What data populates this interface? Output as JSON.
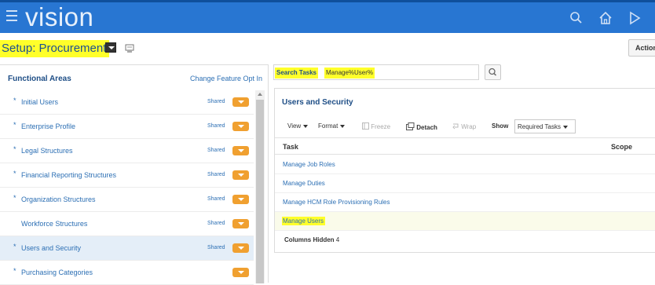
{
  "app": {
    "brand": "vision"
  },
  "topbar_icons": [
    "search-icon",
    "home-icon",
    "navigator-icon"
  ],
  "setup": {
    "title": "Setup: Procurement"
  },
  "action_button": "Action",
  "functional_areas": {
    "header": "Functional Areas",
    "change_link": "Change Feature Opt In",
    "items": [
      {
        "label": "Initial Users",
        "required": true,
        "status": "Shared"
      },
      {
        "label": "Enterprise Profile",
        "required": true,
        "status": "Shared"
      },
      {
        "label": "Legal Structures",
        "required": true,
        "status": "Shared"
      },
      {
        "label": "Financial Reporting Structures",
        "required": true,
        "status": "Shared"
      },
      {
        "label": "Organization Structures",
        "required": true,
        "status": "Shared"
      },
      {
        "label": "Workforce Structures",
        "required": false,
        "status": "Shared"
      },
      {
        "label": "Users and Security",
        "required": true,
        "status": "Shared",
        "selected": true
      },
      {
        "label": "Purchasing Categories",
        "required": true,
        "status": ""
      }
    ]
  },
  "search": {
    "label": "Search Tasks",
    "value": "Manage%User%"
  },
  "panel": {
    "title": "Users and Security",
    "toolbar": {
      "view": "View",
      "format": "Format",
      "freeze": "Freeze",
      "detach": "Detach",
      "wrap": "Wrap",
      "show": "Show",
      "show_value": "Required Tasks"
    },
    "columns": {
      "task": "Task",
      "scope": "Scope"
    },
    "rows": [
      {
        "label": "Manage Job Roles"
      },
      {
        "label": "Manage Duties"
      },
      {
        "label": "Manage HCM Role Provisioning Rules"
      },
      {
        "label": "Manage Users",
        "highlighted": true
      }
    ],
    "columns_hidden_label": "Columns Hidden",
    "columns_hidden_count": "4"
  }
}
